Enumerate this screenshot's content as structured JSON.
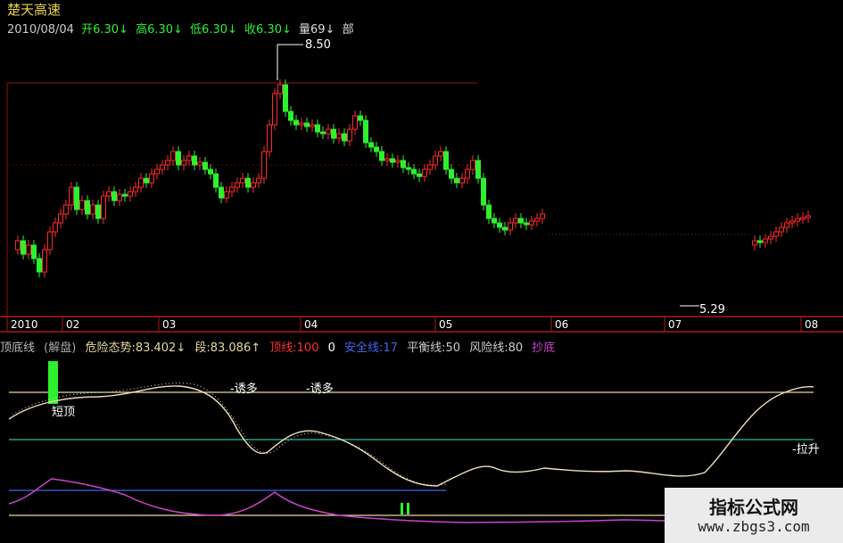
{
  "stock": {
    "name": "楚天高速",
    "date": "2010/08/04",
    "open_label": "开6.30↓",
    "high_label": "高6.30↓",
    "low_label": "低6.30↓",
    "close_label": "收6.30↓",
    "volume_label": "量69↓",
    "extra_label": "部"
  },
  "price_annotations": {
    "high_mark": "8.50",
    "low_mark": "5.29"
  },
  "time_axis": {
    "labels": [
      "2010",
      "02",
      "03",
      "04",
      "05",
      "06",
      "07",
      "08"
    ]
  },
  "indicator": {
    "name_cut": "顶底线",
    "tag": "(解盘)",
    "danger": "危险态势:83.402↓",
    "segment": "段:83.086↑",
    "top_line": "顶线:100",
    "zero": "0",
    "safe_line": "安全线:17",
    "balance_line": "平衡线:50",
    "risk_line": "风险线:80",
    "bottom_fish": "抄底",
    "annot_short_top": "短顶",
    "annot_lure1": "-诱多",
    "annot_lure2": "-诱多",
    "annot_pull": "-拉升"
  },
  "colors": {
    "up": "#ff2a2a",
    "down": "#2ef02e",
    "axis_red": "#b01818",
    "line_white": "#f0e0c0",
    "magenta": "#cc44cc",
    "cyan": "#22c4a0",
    "blue": "#4466ee"
  },
  "chart_data": {
    "type": "candlestick",
    "title": "楚天高速",
    "annotated_prices": {
      "high": 8.5,
      "low": 5.29
    },
    "last_close": 6.3
  },
  "watermark": {
    "title": "指标公式网",
    "url": "www.zbgs3.com"
  }
}
